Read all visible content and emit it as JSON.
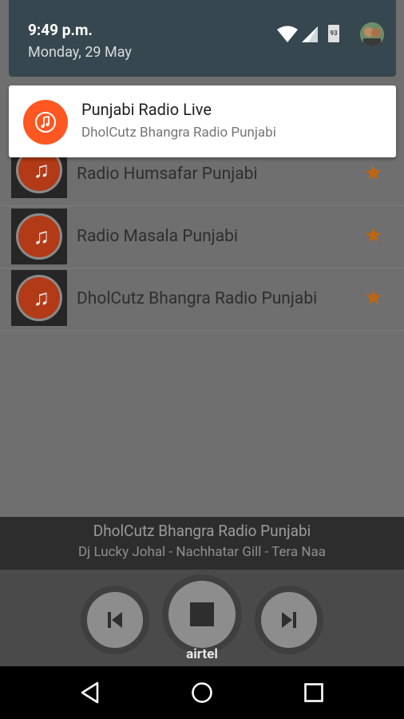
{
  "status_bar": {
    "time": "9:49 p.m.",
    "date": "Monday, 29 May",
    "battery_level": "93",
    "icons": [
      "wifi-icon",
      "cell-signal-icon",
      "battery-icon",
      "user-avatar"
    ]
  },
  "notification": {
    "title": "Punjabi Radio Live",
    "text": "DholCutz Bhangra Radio Punjabi",
    "icon": "music-note-icon",
    "accent": "#ff5722"
  },
  "stations": [
    {
      "name": "Radio Humsafar Punjabi",
      "favorite": true
    },
    {
      "name": "Radio Masala Punjabi",
      "favorite": true
    },
    {
      "name": "DholCutz Bhangra Radio Punjabi",
      "favorite": true
    }
  ],
  "player": {
    "station": "DholCutz Bhangra Radio Punjabi",
    "now_playing": "Dj Lucky Johal - Nachhatar Gill - Tera Naa",
    "controls": [
      "previous-icon",
      "stop-icon",
      "next-icon"
    ]
  },
  "carrier": "airtel",
  "nav": [
    "back-icon",
    "home-icon",
    "recents-icon"
  ],
  "colors": {
    "star": "#c0660f",
    "shade": "#37474f"
  }
}
